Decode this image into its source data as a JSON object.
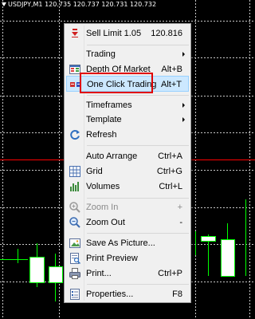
{
  "chart": {
    "symbol": "USDJPY,M1",
    "prices": "120.735 120.737 120.731 120.732",
    "colors": {
      "background": "#000000",
      "grid": "#c8c8c8",
      "candle": "#00ff00",
      "price_line": "#ff0000"
    }
  },
  "menu": {
    "items": [
      {
        "id": "sell-limit",
        "label": "Sell Limit 1.05",
        "shortcut": "120.816",
        "icon": "sell-limit-icon"
      },
      {
        "id": "trading",
        "label": "Trading",
        "submenu": true
      },
      {
        "id": "depth-of-market",
        "label": "Depth Of Market",
        "shortcut": "Alt+B",
        "icon": "depth-of-market-icon"
      },
      {
        "id": "one-click-trading",
        "label": "One Click Trading",
        "shortcut": "Alt+T",
        "icon": "one-click-trading-icon",
        "highlighted": true
      },
      {
        "id": "timeframes",
        "label": "Timeframes",
        "submenu": true
      },
      {
        "id": "template",
        "label": "Template",
        "submenu": true
      },
      {
        "id": "refresh",
        "label": "Refresh",
        "icon": "refresh-icon"
      },
      {
        "id": "auto-arrange",
        "label": "Auto Arrange",
        "shortcut": "Ctrl+A"
      },
      {
        "id": "grid",
        "label": "Grid",
        "shortcut": "Ctrl+G",
        "icon": "grid-icon"
      },
      {
        "id": "volumes",
        "label": "Volumes",
        "shortcut": "Ctrl+L",
        "icon": "volumes-icon"
      },
      {
        "id": "zoom-in",
        "label": "Zoom In",
        "shortcut": "+",
        "icon": "zoom-in-icon",
        "disabled": true
      },
      {
        "id": "zoom-out",
        "label": "Zoom Out",
        "shortcut": "-",
        "icon": "zoom-out-icon"
      },
      {
        "id": "save-as-picture",
        "label": "Save As Picture...",
        "icon": "save-as-picture-icon"
      },
      {
        "id": "print-preview",
        "label": "Print Preview",
        "icon": "print-preview-icon"
      },
      {
        "id": "print",
        "label": "Print...",
        "shortcut": "Ctrl+P",
        "icon": "print-icon"
      },
      {
        "id": "properties",
        "label": "Properties...",
        "shortcut": "F8",
        "icon": "properties-icon"
      }
    ]
  }
}
